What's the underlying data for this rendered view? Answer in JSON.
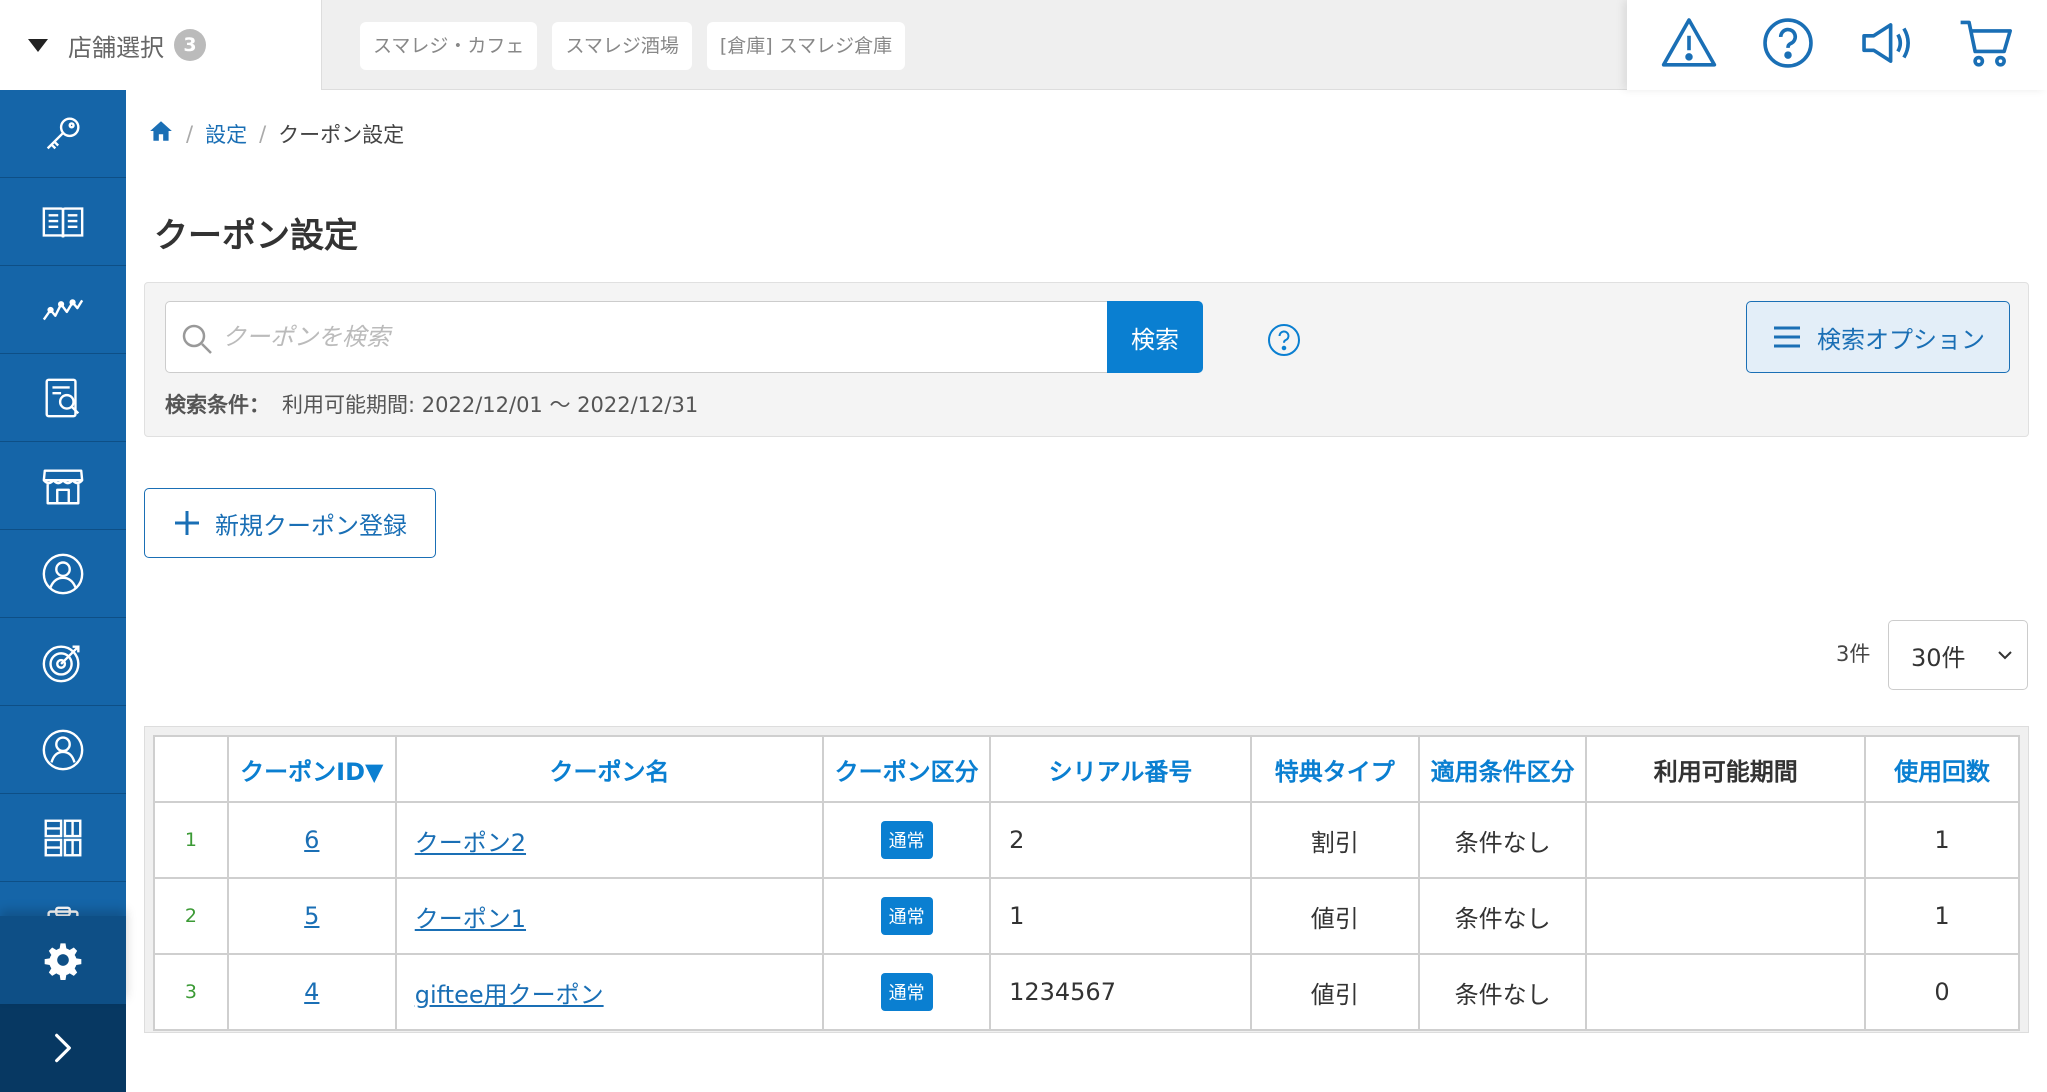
{
  "header": {
    "store_select_label": "店舗選択",
    "store_count": "3",
    "store_tabs": [
      "スマレジ・カフェ",
      "スマレジ酒場",
      "[倉庫] スマレジ倉庫"
    ]
  },
  "breadcrumb": {
    "items": [
      "設定",
      "クーポン設定"
    ]
  },
  "page": {
    "title": "クーポン設定"
  },
  "search": {
    "placeholder": "クーポンを検索",
    "value": "",
    "button_label": "検索",
    "options_label": "検索オプション",
    "condition_label": "検索条件：",
    "condition_value": "利用可能期間: 2022/12/01 〜 2022/12/31"
  },
  "actions": {
    "new_coupon_label": "新規クーポン登録"
  },
  "results": {
    "count_text": "3件",
    "per_page": "30件"
  },
  "table": {
    "headers": [
      "クーポンID▼",
      "クーポン名",
      "クーポン区分",
      "シリアル番号",
      "特典タイプ",
      "適用条件区分",
      "利用可能期間",
      "使用回数"
    ],
    "rows": [
      {
        "index": "1",
        "id": "6",
        "name": "クーポン2",
        "category": "通常",
        "serial": "2",
        "benefit": "割引",
        "condition": "条件なし",
        "period": "",
        "uses": "1"
      },
      {
        "index": "2",
        "id": "5",
        "name": "クーポン1",
        "category": "通常",
        "serial": "1",
        "benefit": "値引",
        "condition": "条件なし",
        "period": "",
        "uses": "1"
      },
      {
        "index": "3",
        "id": "4",
        "name": "giftee用クーポン",
        "category": "通常",
        "serial": "1234567",
        "benefit": "値引",
        "condition": "条件なし",
        "period": "",
        "uses": "0"
      }
    ]
  },
  "icons": {
    "top": [
      "alert-icon",
      "help-icon",
      "announcement-icon",
      "cart-icon"
    ],
    "sidebar": [
      "key-icon",
      "book-icon",
      "chart-icon",
      "report-icon",
      "store-icon",
      "customer-icon",
      "target-icon",
      "staff-icon",
      "grid-icon",
      "clipboard-icon",
      "gear-icon",
      "expand-icon"
    ]
  },
  "colors": {
    "primary": "#0a7fd1",
    "sidebar": "#1565a8",
    "link": "#1a6fb5",
    "index_green": "#3b9a35"
  }
}
